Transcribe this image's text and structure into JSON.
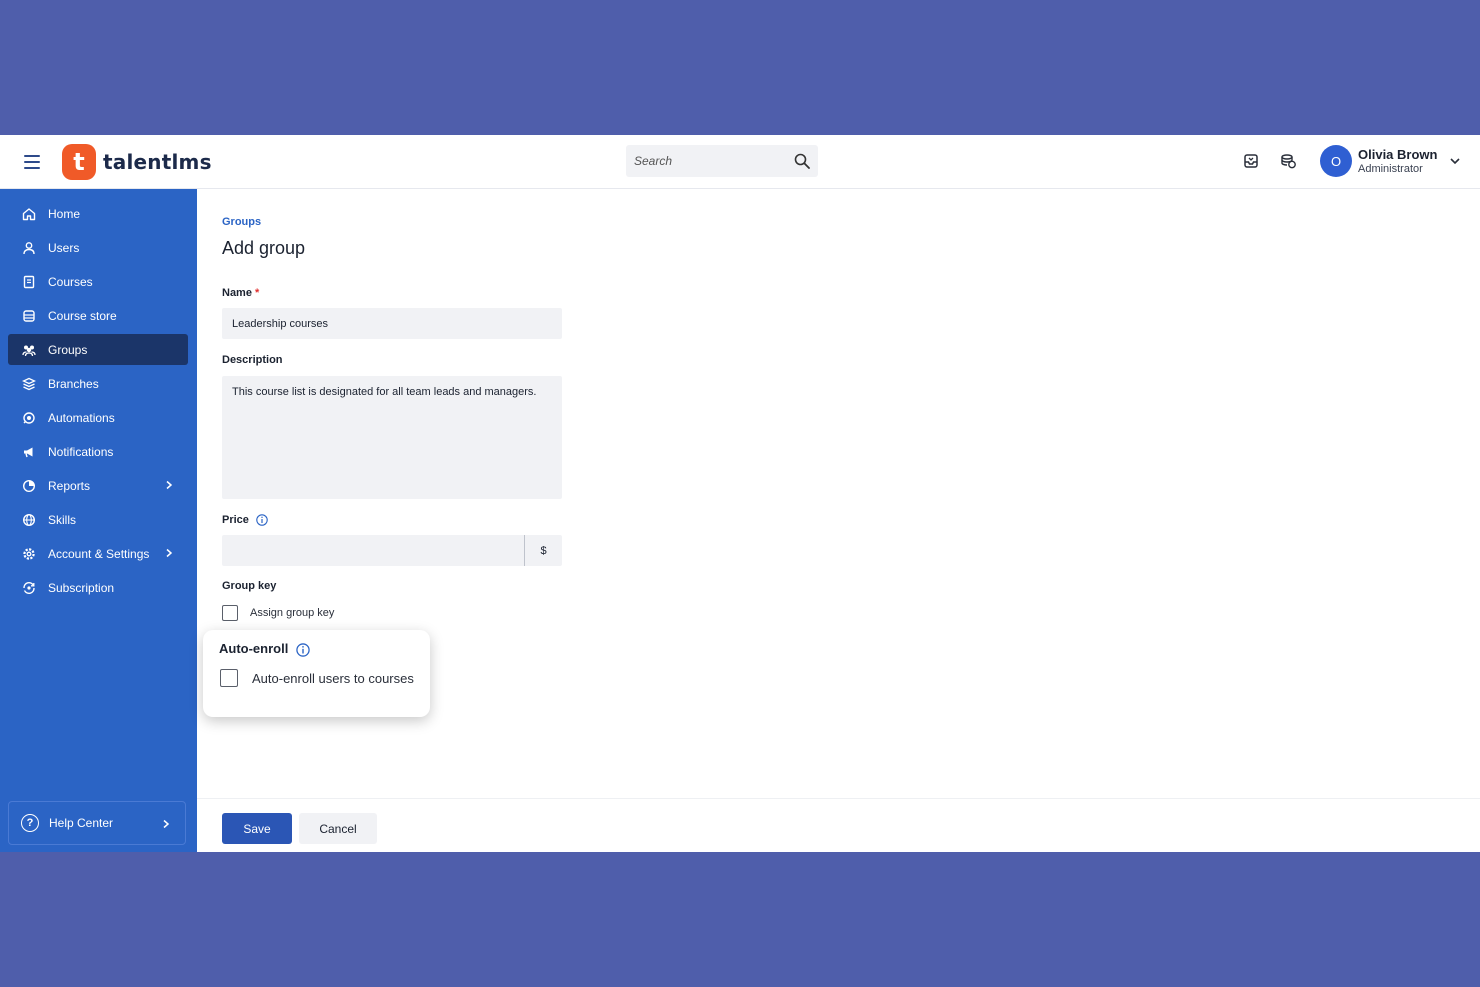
{
  "brand": {
    "name": "talentlms",
    "mark": "t"
  },
  "search": {
    "placeholder": "Search"
  },
  "user": {
    "initial": "O",
    "name": "Olivia Brown",
    "role": "Administrator"
  },
  "topbar_icons": [
    "inbox-icon",
    "coins-icon",
    "chevron-down-icon"
  ],
  "sidebar": {
    "items": [
      {
        "label": "Home",
        "icon": "home-icon"
      },
      {
        "label": "Users",
        "icon": "user-icon"
      },
      {
        "label": "Courses",
        "icon": "book-icon"
      },
      {
        "label": "Course store",
        "icon": "store-icon"
      },
      {
        "label": "Groups",
        "icon": "group-icon",
        "active": true
      },
      {
        "label": "Branches",
        "icon": "layers-icon"
      },
      {
        "label": "Automations",
        "icon": "automation-icon"
      },
      {
        "label": "Notifications",
        "icon": "megaphone-icon"
      },
      {
        "label": "Reports",
        "icon": "pie-chart-icon",
        "has_submenu": true
      },
      {
        "label": "Skills",
        "icon": "globe-icon"
      },
      {
        "label": "Account & Settings",
        "icon": "gear-icon",
        "has_submenu": true
      },
      {
        "label": "Subscription",
        "icon": "refresh-money-icon"
      }
    ],
    "help": {
      "label": "Help Center",
      "icon": "question-icon"
    }
  },
  "main": {
    "breadcrumb": "Groups",
    "title": "Add group",
    "name": {
      "label": "Name",
      "required_mark": "*",
      "value": "Leadership courses"
    },
    "description": {
      "label": "Description",
      "value": "This course list is designated for all team leads and managers."
    },
    "price": {
      "label": "Price",
      "value": "",
      "currency": "$"
    },
    "group_key": {
      "label": "Group key",
      "checkbox_label": "Assign group key",
      "checked": false
    },
    "auto_enroll": {
      "label": "Auto-enroll",
      "checkbox_label": "Auto-enroll users to courses",
      "checked": false
    }
  },
  "footer": {
    "save_label": "Save",
    "cancel_label": "Cancel"
  },
  "colors": {
    "page_bg": "#4f5eab",
    "sidebar": "#2b64c5",
    "sidebar_active": "#1b3569",
    "brand_orange": "#f05a28",
    "primary_button": "#2b56b5"
  }
}
